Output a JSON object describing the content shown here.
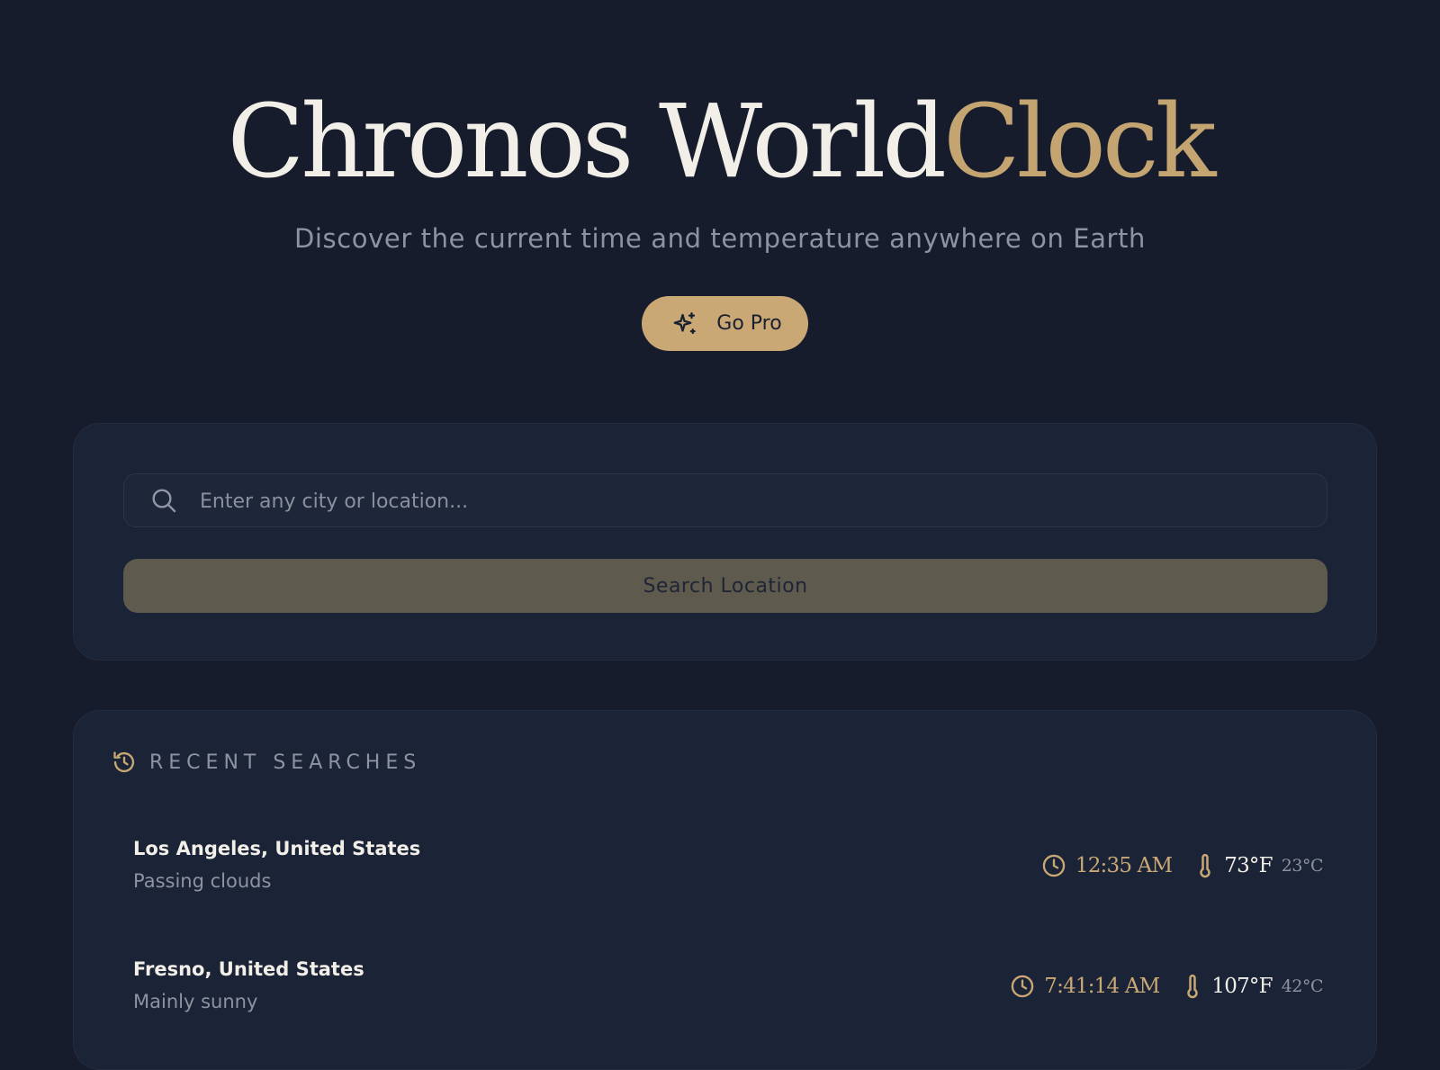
{
  "hero": {
    "title_part1": "Chronos World",
    "title_part2": "Clock",
    "subtitle": "Discover the current time and temperature anywhere on Earth",
    "go_pro_label": "Go Pro"
  },
  "search": {
    "placeholder": "Enter any city or location...",
    "value": "",
    "button_label": "Search Location"
  },
  "recent": {
    "heading": "RECENT SEARCHES",
    "items": [
      {
        "city": "Los Angeles, United States",
        "condition": "Passing clouds",
        "time": "12:35 AM",
        "temp_f": "73°F",
        "temp_c": "23°C"
      },
      {
        "city": "Fresno, United States",
        "condition": "Mainly sunny",
        "time": "7:41:14 AM",
        "temp_f": "107°F",
        "temp_c": "42°C"
      }
    ]
  },
  "colors": {
    "background": "#161c2c",
    "card": "#1b2336",
    "accent_gold": "#c9a876",
    "text_light": "#f1efe8",
    "text_muted": "#8d93a1"
  },
  "icons": {
    "go_pro": "sparkles-icon",
    "search": "search-icon",
    "recent": "history-icon",
    "time": "clock-icon",
    "temperature": "thermometer-icon"
  }
}
